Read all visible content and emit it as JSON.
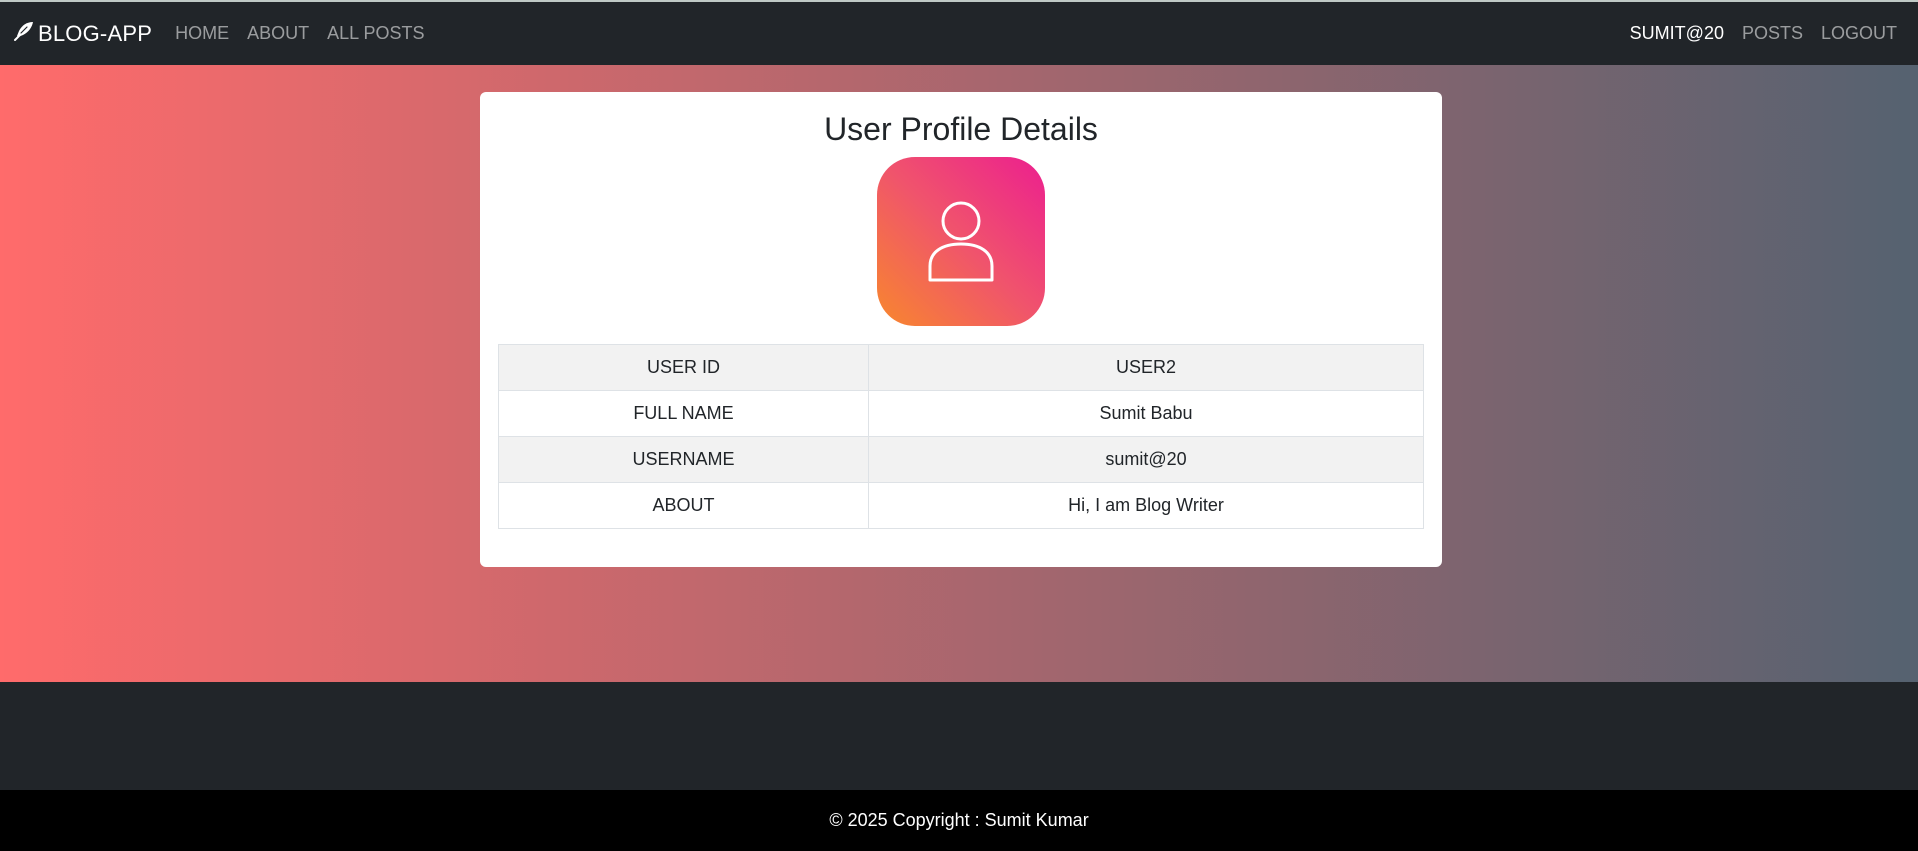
{
  "navbar": {
    "brand": "BLOG-APP",
    "left_links": [
      "HOME",
      "ABOUT",
      "ALL POSTS"
    ],
    "right_links": [
      "SUMIT@20",
      "POSTS",
      "LOGOUT"
    ]
  },
  "profile": {
    "title": "User Profile Details",
    "avatar_icon": "user-icon",
    "rows": [
      {
        "key": "USER ID",
        "value": "USER2"
      },
      {
        "key": "FULL NAME",
        "value": "Sumit Babu"
      },
      {
        "key": "USERNAME",
        "value": "sumit@20"
      },
      {
        "key": "ABOUT",
        "value": "Hi, I am Blog Writer"
      }
    ]
  },
  "footer": {
    "copyright": "© 2025 Copyright : Sumit Kumar"
  },
  "colors": {
    "navbar_bg": "#212529",
    "gradient_start": "#ff6b6b",
    "gradient_end": "#556270",
    "avatar_gradient": [
      "#ec1f8f",
      "#f8872d"
    ],
    "footer_bg": "#000000"
  }
}
